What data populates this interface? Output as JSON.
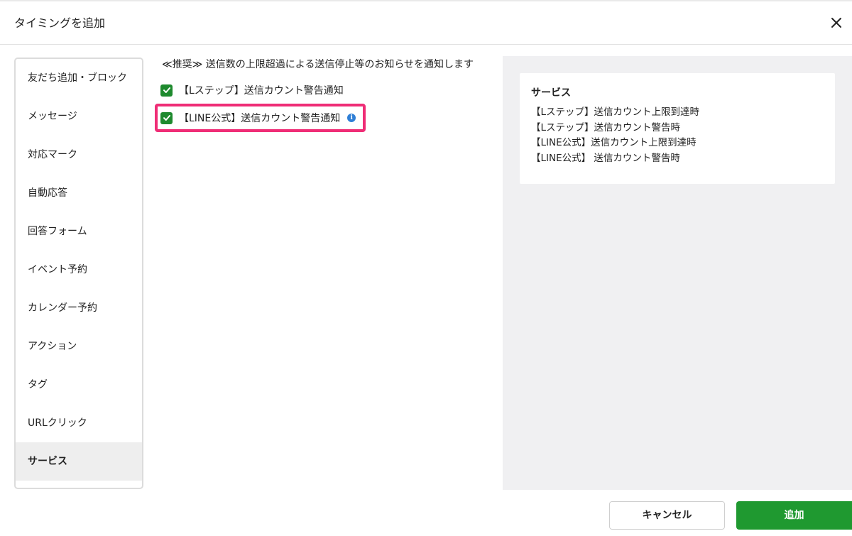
{
  "header": {
    "title": "タイミングを追加"
  },
  "sidebar": {
    "items": [
      {
        "label": "友だち追加・ブロック",
        "active": false
      },
      {
        "label": "メッセージ",
        "active": false
      },
      {
        "label": "対応マーク",
        "active": false
      },
      {
        "label": "自動応答",
        "active": false
      },
      {
        "label": "回答フォーム",
        "active": false
      },
      {
        "label": "イベント予約",
        "active": false
      },
      {
        "label": "カレンダー予約",
        "active": false
      },
      {
        "label": "アクション",
        "active": false
      },
      {
        "label": "タグ",
        "active": false
      },
      {
        "label": "URLクリック",
        "active": false
      },
      {
        "label": "サービス",
        "active": true
      }
    ]
  },
  "middle": {
    "recommend_text": "≪推奨≫ 送信数の上限超過による送信停止等のお知らせを通知します",
    "options": [
      {
        "label": "【Lステップ】送信カウント警告通知",
        "checked": true
      },
      {
        "label": "【LINE公式】送信カウント警告通知",
        "checked": true,
        "info_icon": "info-icon"
      }
    ]
  },
  "service_panel": {
    "title": "サービス",
    "lines": [
      "【Lステップ】送信カウント上限到達時",
      "【Lステップ】送信カウント警告時",
      "【LINE公式】送信カウント上限到達時",
      "【LINE公式】 送信カウント警告時"
    ]
  },
  "footer": {
    "cancel_label": "キャンセル",
    "add_label": "追加"
  },
  "colors": {
    "accent_green": "#1f9930",
    "checkbox_green": "#1e8a2e",
    "highlight_pink": "#ef2d76",
    "info_blue": "#2f7fd6",
    "panel_bg": "#f0f0f2"
  }
}
